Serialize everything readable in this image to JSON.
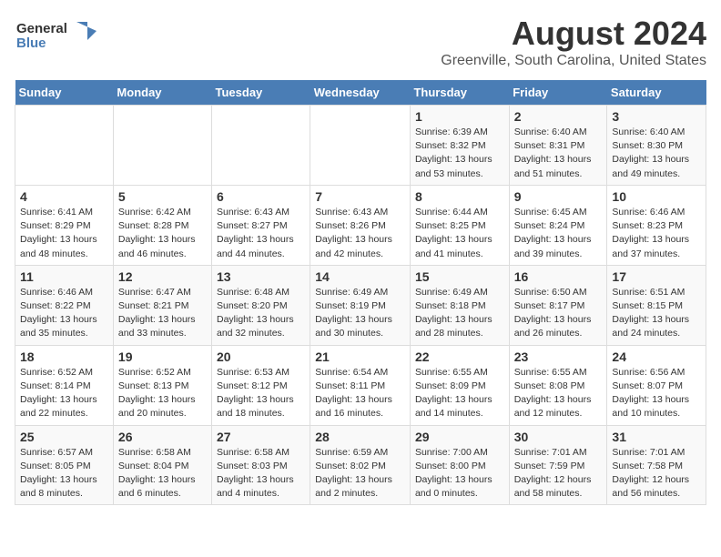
{
  "header": {
    "logo_general": "General",
    "logo_blue": "Blue",
    "main_title": "August 2024",
    "subtitle": "Greenville, South Carolina, United States"
  },
  "calendar": {
    "days_of_week": [
      "Sunday",
      "Monday",
      "Tuesday",
      "Wednesday",
      "Thursday",
      "Friday",
      "Saturday"
    ],
    "weeks": [
      [
        {
          "day": "",
          "sunrise": "",
          "sunset": "",
          "daylight": ""
        },
        {
          "day": "",
          "sunrise": "",
          "sunset": "",
          "daylight": ""
        },
        {
          "day": "",
          "sunrise": "",
          "sunset": "",
          "daylight": ""
        },
        {
          "day": "",
          "sunrise": "",
          "sunset": "",
          "daylight": ""
        },
        {
          "day": "1",
          "sunrise": "Sunrise: 6:39 AM",
          "sunset": "Sunset: 8:32 PM",
          "daylight": "Daylight: 13 hours and 53 minutes."
        },
        {
          "day": "2",
          "sunrise": "Sunrise: 6:40 AM",
          "sunset": "Sunset: 8:31 PM",
          "daylight": "Daylight: 13 hours and 51 minutes."
        },
        {
          "day": "3",
          "sunrise": "Sunrise: 6:40 AM",
          "sunset": "Sunset: 8:30 PM",
          "daylight": "Daylight: 13 hours and 49 minutes."
        }
      ],
      [
        {
          "day": "4",
          "sunrise": "Sunrise: 6:41 AM",
          "sunset": "Sunset: 8:29 PM",
          "daylight": "Daylight: 13 hours and 48 minutes."
        },
        {
          "day": "5",
          "sunrise": "Sunrise: 6:42 AM",
          "sunset": "Sunset: 8:28 PM",
          "daylight": "Daylight: 13 hours and 46 minutes."
        },
        {
          "day": "6",
          "sunrise": "Sunrise: 6:43 AM",
          "sunset": "Sunset: 8:27 PM",
          "daylight": "Daylight: 13 hours and 44 minutes."
        },
        {
          "day": "7",
          "sunrise": "Sunrise: 6:43 AM",
          "sunset": "Sunset: 8:26 PM",
          "daylight": "Daylight: 13 hours and 42 minutes."
        },
        {
          "day": "8",
          "sunrise": "Sunrise: 6:44 AM",
          "sunset": "Sunset: 8:25 PM",
          "daylight": "Daylight: 13 hours and 41 minutes."
        },
        {
          "day": "9",
          "sunrise": "Sunrise: 6:45 AM",
          "sunset": "Sunset: 8:24 PM",
          "daylight": "Daylight: 13 hours and 39 minutes."
        },
        {
          "day": "10",
          "sunrise": "Sunrise: 6:46 AM",
          "sunset": "Sunset: 8:23 PM",
          "daylight": "Daylight: 13 hours and 37 minutes."
        }
      ],
      [
        {
          "day": "11",
          "sunrise": "Sunrise: 6:46 AM",
          "sunset": "Sunset: 8:22 PM",
          "daylight": "Daylight: 13 hours and 35 minutes."
        },
        {
          "day": "12",
          "sunrise": "Sunrise: 6:47 AM",
          "sunset": "Sunset: 8:21 PM",
          "daylight": "Daylight: 13 hours and 33 minutes."
        },
        {
          "day": "13",
          "sunrise": "Sunrise: 6:48 AM",
          "sunset": "Sunset: 8:20 PM",
          "daylight": "Daylight: 13 hours and 32 minutes."
        },
        {
          "day": "14",
          "sunrise": "Sunrise: 6:49 AM",
          "sunset": "Sunset: 8:19 PM",
          "daylight": "Daylight: 13 hours and 30 minutes."
        },
        {
          "day": "15",
          "sunrise": "Sunrise: 6:49 AM",
          "sunset": "Sunset: 8:18 PM",
          "daylight": "Daylight: 13 hours and 28 minutes."
        },
        {
          "day": "16",
          "sunrise": "Sunrise: 6:50 AM",
          "sunset": "Sunset: 8:17 PM",
          "daylight": "Daylight: 13 hours and 26 minutes."
        },
        {
          "day": "17",
          "sunrise": "Sunrise: 6:51 AM",
          "sunset": "Sunset: 8:15 PM",
          "daylight": "Daylight: 13 hours and 24 minutes."
        }
      ],
      [
        {
          "day": "18",
          "sunrise": "Sunrise: 6:52 AM",
          "sunset": "Sunset: 8:14 PM",
          "daylight": "Daylight: 13 hours and 22 minutes."
        },
        {
          "day": "19",
          "sunrise": "Sunrise: 6:52 AM",
          "sunset": "Sunset: 8:13 PM",
          "daylight": "Daylight: 13 hours and 20 minutes."
        },
        {
          "day": "20",
          "sunrise": "Sunrise: 6:53 AM",
          "sunset": "Sunset: 8:12 PM",
          "daylight": "Daylight: 13 hours and 18 minutes."
        },
        {
          "day": "21",
          "sunrise": "Sunrise: 6:54 AM",
          "sunset": "Sunset: 8:11 PM",
          "daylight": "Daylight: 13 hours and 16 minutes."
        },
        {
          "day": "22",
          "sunrise": "Sunrise: 6:55 AM",
          "sunset": "Sunset: 8:09 PM",
          "daylight": "Daylight: 13 hours and 14 minutes."
        },
        {
          "day": "23",
          "sunrise": "Sunrise: 6:55 AM",
          "sunset": "Sunset: 8:08 PM",
          "daylight": "Daylight: 13 hours and 12 minutes."
        },
        {
          "day": "24",
          "sunrise": "Sunrise: 6:56 AM",
          "sunset": "Sunset: 8:07 PM",
          "daylight": "Daylight: 13 hours and 10 minutes."
        }
      ],
      [
        {
          "day": "25",
          "sunrise": "Sunrise: 6:57 AM",
          "sunset": "Sunset: 8:05 PM",
          "daylight": "Daylight: 13 hours and 8 minutes."
        },
        {
          "day": "26",
          "sunrise": "Sunrise: 6:58 AM",
          "sunset": "Sunset: 8:04 PM",
          "daylight": "Daylight: 13 hours and 6 minutes."
        },
        {
          "day": "27",
          "sunrise": "Sunrise: 6:58 AM",
          "sunset": "Sunset: 8:03 PM",
          "daylight": "Daylight: 13 hours and 4 minutes."
        },
        {
          "day": "28",
          "sunrise": "Sunrise: 6:59 AM",
          "sunset": "Sunset: 8:02 PM",
          "daylight": "Daylight: 13 hours and 2 minutes."
        },
        {
          "day": "29",
          "sunrise": "Sunrise: 7:00 AM",
          "sunset": "Sunset: 8:00 PM",
          "daylight": "Daylight: 13 hours and 0 minutes."
        },
        {
          "day": "30",
          "sunrise": "Sunrise: 7:01 AM",
          "sunset": "Sunset: 7:59 PM",
          "daylight": "Daylight: 12 hours and 58 minutes."
        },
        {
          "day": "31",
          "sunrise": "Sunrise: 7:01 AM",
          "sunset": "Sunset: 7:58 PM",
          "daylight": "Daylight: 12 hours and 56 minutes."
        }
      ]
    ]
  }
}
